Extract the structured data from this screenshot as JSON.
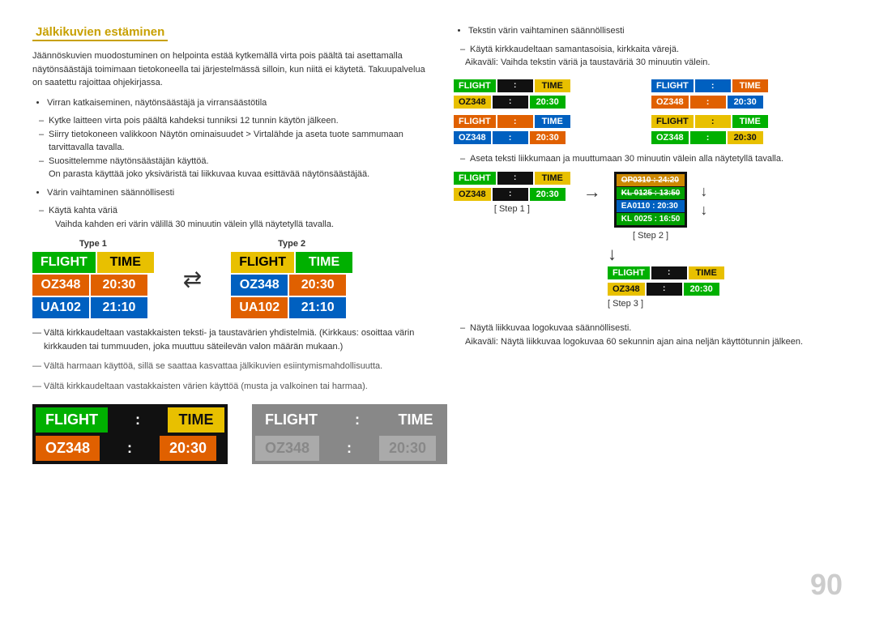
{
  "page": {
    "number": "90"
  },
  "left": {
    "title": "Jälkikuvien estäminen",
    "intro": "Jäännöskuvien muodostuminen on helpointa estää kytkemällä virta pois päältä tai asettamalla näytönsäästäjä toimimaan tietokoneella tai järjestelmässä silloin, kun niitä ei käytetä. Takuupalvelua on saatettu rajoittaa ohjekirjassa.",
    "section1_title": "Virran katkaiseminen, näytönsäästäjä ja virransäästötila",
    "section1_items": [
      "Kytke laitteen virta pois päältä kahdeksi tunniksi 12 tunnin käytön jälkeen.",
      "Siirry tietokoneen valikkoon Näytön ominaisuudet > Virtalähde ja aseta tuote sammumaan tarvittavalla tavalla.",
      "Suosittelemme näytönsäästäjän käyttöä.\nOn parasta käyttää joko yksiväristä tai liikkuvaa kuvaa esittävää näytönsäästäjää."
    ],
    "section2_title": "Värin vaihtaminen säännöllisesti",
    "section2_items": [
      "Käytä kahta väriä",
      "Vaihda kahden eri värin välillä 30 minuutin välein yllä näytetyllä tavalla."
    ],
    "type1_label": "Type 1",
    "type2_label": "Type 2",
    "board_rows": [
      {
        "col1": "FLIGHT",
        "col2": "TIME"
      },
      {
        "col1": "OZ348",
        "col2": "20:30"
      },
      {
        "col1": "UA102",
        "col2": "21:10"
      }
    ],
    "warn1": "Vältä kirkkaudeltaan vastakkaisten teksti- ja taustavärien yhdistelmiä.\n(Kirkkaus: osoittaa värin kirkkauden tai tummuuden, joka muuttuu säteilevän valon määrän mukaan.)",
    "warn2": "Vältä harmaan käyttöä, sillä se saattaa kasvattaa jälkikuvien esiintymismahdollisuutta.",
    "warn3": "Vältä kirkkaudeltaan vastakkaisten värien käyttöä (musta ja valkoinen tai harmaa).",
    "bottom_board1_rows": [
      {
        "col1": "FLIGHT",
        "col2": ":",
        "col3": "TIME"
      },
      {
        "col1": "OZ348",
        "col2": ":",
        "col3": "20:30"
      }
    ],
    "bottom_board2_rows": [
      {
        "col1": "FLIGHT",
        "col2": ":",
        "col3": "TIME"
      },
      {
        "col1": "OZ348",
        "col2": ":",
        "col3": "20:30"
      }
    ]
  },
  "right": {
    "color_rule_title": "Tekstin värin vaihtaminen säännöllisesti",
    "color_rule_sub": "Käytä kirkkaudeltaan samantasoisia, kirkkaita värejä.",
    "color_rule_detail": "Aikaväli: Vaihda tekstin väriä ja taustaväriä 30 minuutin välein.",
    "boards_2x2": [
      {
        "header1": "FLIGHT",
        "header2": "TIME",
        "header1_bg": "bg-green",
        "header2_bg": "bg-yellow",
        "row1": "OZ348",
        "row2": "20:30",
        "row1_bg": "bg-yellow",
        "row2_bg": "bg-green"
      },
      {
        "header1": "FLIGHT",
        "header2": "TIME",
        "header1_bg": "bg-blue",
        "header2_bg": "bg-orange",
        "row1": "OZ348",
        "row2": "20:30",
        "row1_bg": "bg-orange",
        "row2_bg": "bg-blue"
      },
      {
        "header1": "FLIGHT",
        "header2": "TIME",
        "header1_bg": "bg-orange",
        "header2_bg": "bg-blue",
        "row1": "OZ348",
        "row2": "20:30",
        "row1_bg": "bg-blue",
        "row2_bg": "bg-orange"
      },
      {
        "header1": "FLIGHT",
        "header2": "TIME",
        "header1_bg": "bg-yellow",
        "header2_bg": "bg-green",
        "row1": "OZ348",
        "row2": "20:30",
        "row1_bg": "bg-green",
        "row2_bg": "bg-yellow"
      }
    ],
    "step_rule": "Aseta teksti liikkumaan ja muuttumaan 30 minuutin välein alla näytetyllä tavalla.",
    "step1_label": "[ Step 1 ]",
    "step2_label": "[ Step 2 ]",
    "step3_label": "[ Step 3 ]",
    "step1_board": [
      {
        "col1": "FLIGHT",
        "col2": "TIME",
        "bg1": "bg-green",
        "bg2": "bg-yellow"
      },
      {
        "col1": "OZ348",
        "col2": "20:30",
        "bg1": "bg-yellow",
        "bg2": "bg-green"
      }
    ],
    "step2_lines": [
      "OP0310 : 24:20",
      "KL 0125 : 13:50",
      "EA0110 : 20:30",
      "KL 0025 : 16:50"
    ],
    "step3_board": [
      {
        "col1": "FLIGHT",
        "col2": "TIME",
        "bg1": "bg-green",
        "bg2": "bg-yellow"
      },
      {
        "col1": "OZ348",
        "col2": "20:30",
        "bg1": "bg-yellow",
        "bg2": "bg-green"
      }
    ],
    "logo_rule": "Näytä liikkuvaa logokuvaa säännöllisesti.",
    "logo_rule_detail": "Aikaväli: Näytä liikkuvaa logokuvaa 60 sekunnin ajan aina neljän käyttötunnin jälkeen."
  }
}
